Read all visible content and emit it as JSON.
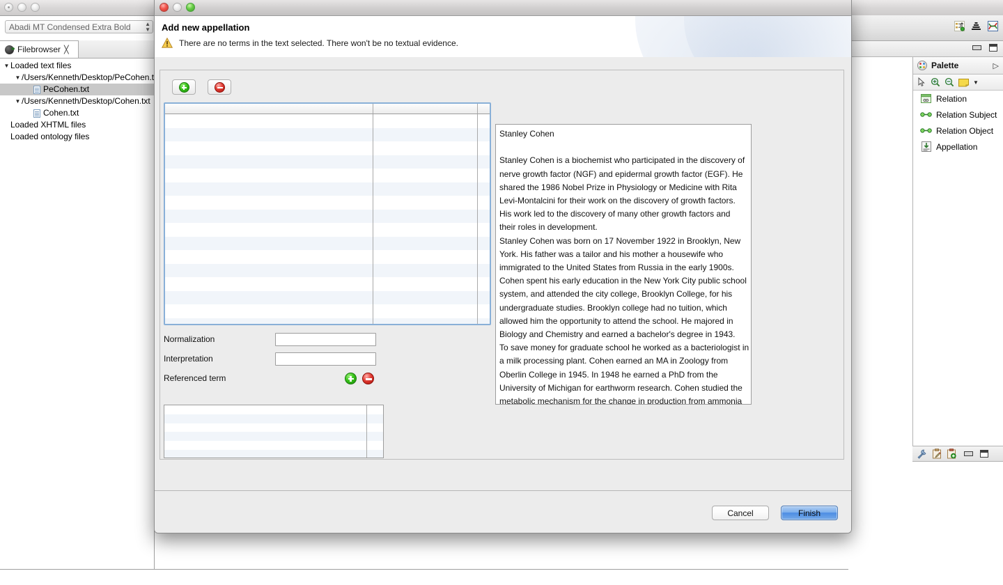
{
  "background_window": {
    "font_combo": {
      "value": "Abadi MT Condensed Extra Bold"
    },
    "tab": {
      "label": "Filebrowser",
      "close_glyph": "╳",
      "icon": "globe-icon"
    },
    "tree": [
      {
        "label": "Loaded text files",
        "indent": 0,
        "twisty": "▼",
        "type": "folder",
        "selected": false
      },
      {
        "label": "/Users/Kenneth/Desktop/PeCohen.txt",
        "indent": 1,
        "twisty": "▼",
        "type": "folder",
        "selected": false
      },
      {
        "label": "PeCohen.txt",
        "indent": 2,
        "twisty": "",
        "type": "file",
        "selected": true
      },
      {
        "label": "/Users/Kenneth/Desktop/Cohen.txt",
        "indent": 1,
        "twisty": "▼",
        "type": "folder",
        "selected": false
      },
      {
        "label": "Cohen.txt",
        "indent": 2,
        "twisty": "",
        "type": "file",
        "selected": false
      },
      {
        "label": "Loaded XHTML files",
        "indent": 0,
        "twisty": "",
        "type": "plain",
        "selected": false
      },
      {
        "label": "Loaded ontology files",
        "indent": 0,
        "twisty": "",
        "type": "plain",
        "selected": false
      }
    ]
  },
  "right_dock": {
    "toolbar_icons": [
      "hierarchy-icon",
      "pyramid-icon",
      "chart-icon"
    ],
    "window_buttons": [
      "minimize-icon",
      "maximize-icon"
    ],
    "palette": {
      "title": "Palette",
      "collapse_glyph": "▷",
      "tools": [
        "select-arrow-icon",
        "zoom-in-icon",
        "zoom-out-icon",
        "note-icon",
        "dropdown-arrow-icon"
      ],
      "entries": [
        {
          "label": "Relation",
          "icon": "relation-icon"
        },
        {
          "label": "Relation Subject",
          "icon": "relation-subject-icon"
        },
        {
          "label": "Relation Object",
          "icon": "relation-object-icon"
        },
        {
          "label": "Appellation",
          "icon": "appellation-icon"
        }
      ]
    },
    "lower_toolbar_icons": [
      "wrench-icon",
      "clipboard-edit-icon",
      "clipboard-add-icon",
      "minimize-icon",
      "maximize-icon"
    ]
  },
  "dialog": {
    "title": "Add new appellation",
    "message": "There are no terms in the text selected. There won't be no textual evidence.",
    "message_icon": "warning-icon",
    "toolbar": {
      "add_label": "add-button",
      "remove_label": "remove-button"
    },
    "appellation_table": {
      "columns": [
        "",
        "",
        ""
      ],
      "rows": []
    },
    "form": {
      "normalization": {
        "label": "Normalization",
        "value": "",
        "placeholder": ""
      },
      "interpretation": {
        "label": "Interpretation",
        "value": "",
        "placeholder": ""
      },
      "referenced_term": {
        "label": "Referenced term",
        "add_icon": "plus-icon",
        "remove_icon": "minus-icon"
      },
      "referenced_table_rows": []
    },
    "text_viewer": {
      "heading": "Stanley Cohen",
      "lines": [
        "Stanley Cohen",
        "",
        "Stanley Cohen is a biochemist who participated in the discovery of",
        "nerve growth factor (NGF) and epidermal growth factor (EGF).  He",
        "shared the 1986 Nobel Prize in Physiology or Medicine with Rita",
        "Levi-Montalcini for their work on the discovery of growth factors.",
        "His work led to the discovery of many other growth factors and",
        "their roles in development.",
        "Stanley Cohen was born on 17 November 1922 in Brooklyn, New",
        "York.  His father was a tailor and his mother a housewife who",
        "immigrated to the United States from Russia in the early 1900s.",
        "Cohen spent his early education in the New York City public school",
        "system, and attended the city college, Brooklyn College, for his",
        "undergraduate studies.  Brooklyn college had no tuition, which",
        "allowed him the opportunity to attend the school.   He majored in",
        "Biology and Chemistry and earned a bachelor's degree in 1943.",
        "To save money for graduate school he worked as a bacteriologist in",
        "a milk processing plant.  Cohen earned an MA in Zoology from",
        "Oberlin College in 1945.  In 1948 he earned a PhD from the",
        "University of Michigan for earthworm research.  Cohen studied the",
        "metabolic mechanism for the change in production from ammonia"
      ]
    },
    "buttons": {
      "cancel": "Cancel",
      "finish": "Finish"
    }
  },
  "colors": {
    "accent_blue": "#4d8de3",
    "table_stripe": "#f1f5fa",
    "table_focus_border": "#89b0d8",
    "dialog_bg": "#ececec",
    "selection_gray": "#c8c8c8",
    "green_icon": "#37c219",
    "red_icon": "#e23b32",
    "warning_yellow": "#f0c330"
  }
}
